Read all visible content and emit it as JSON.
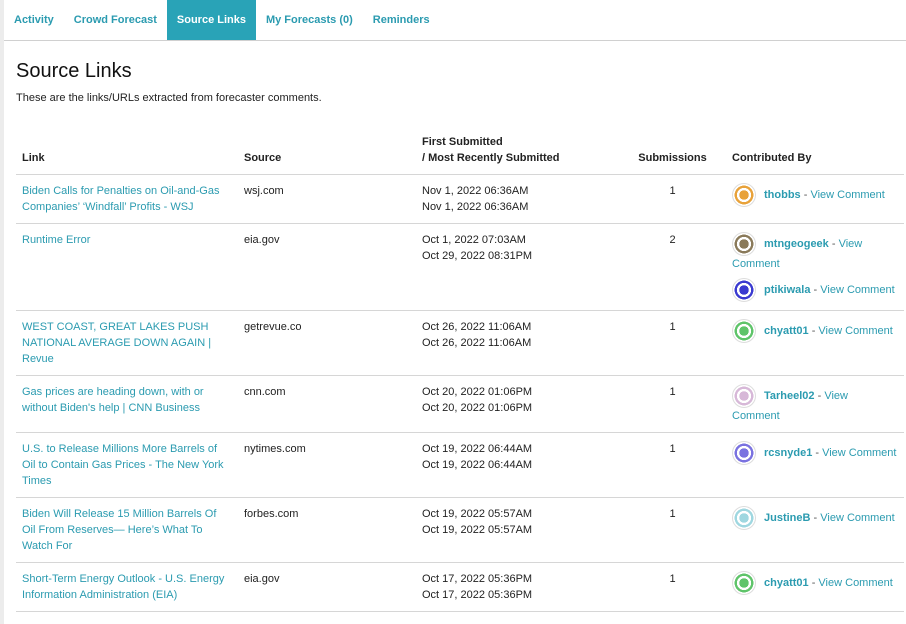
{
  "tabs": [
    {
      "label": "Activity",
      "active": false
    },
    {
      "label": "Crowd Forecast",
      "active": false
    },
    {
      "label": "Source Links",
      "active": true
    },
    {
      "label": "My Forecasts (0)",
      "active": false
    },
    {
      "label": "Reminders",
      "active": false
    }
  ],
  "page_title": "Source Links",
  "subtitle": "These are the links/URLs extracted from forecaster comments.",
  "columns": {
    "link": "Link",
    "source": "Source",
    "date_line1": "First Submitted",
    "date_line2": "/ Most Recently Submitted",
    "submissions": "Submissions",
    "contributed": "Contributed By"
  },
  "view_comment_label": "View Comment",
  "rows": [
    {
      "link": "Biden Calls for Penalties on Oil-and-Gas Companies’ ‘Windfall’ Profits - WSJ",
      "source": "wsj.com",
      "first": "Nov 1, 2022 06:36AM",
      "recent": "Nov 1, 2022 06:36AM",
      "submissions": "1",
      "contributors": [
        {
          "name": "thobbs",
          "color": "#e8a23a"
        }
      ]
    },
    {
      "link": "Runtime Error",
      "source": "eia.gov",
      "first": "Oct 1, 2022 07:03AM",
      "recent": "Oct 29, 2022 08:31PM",
      "submissions": "2",
      "contributors": [
        {
          "name": "mtngeogeek",
          "color": "#8a7a5a"
        },
        {
          "name": "ptikiwala",
          "color": "#3a3ad0"
        }
      ]
    },
    {
      "link": "WEST COAST, GREAT LAKES PUSH NATIONAL AVERAGE DOWN AGAIN | Revue",
      "source": "getrevue.co",
      "first": "Oct 26, 2022 11:06AM",
      "recent": "Oct 26, 2022 11:06AM",
      "submissions": "1",
      "contributors": [
        {
          "name": "chyatt01",
          "color": "#5fc46a"
        }
      ]
    },
    {
      "link": "Gas prices are heading down, with or without Biden's help | CNN Business",
      "source": "cnn.com",
      "first": "Oct 20, 2022 01:06PM",
      "recent": "Oct 20, 2022 01:06PM",
      "submissions": "1",
      "contributors": [
        {
          "name": "Tarheel02",
          "color": "#d7b8d8"
        }
      ]
    },
    {
      "link": "U.S. to Release Millions More Barrels of Oil to Contain Gas Prices - The New York Times",
      "source": "nytimes.com",
      "first": "Oct 19, 2022 06:44AM",
      "recent": "Oct 19, 2022 06:44AM",
      "submissions": "1",
      "contributors": [
        {
          "name": "rcsnyde1",
          "color": "#7a72e0"
        }
      ]
    },
    {
      "link": "Biden Will Release 15 Million Barrels Of Oil From Reserves— Here’s What To Watch For",
      "source": "forbes.com",
      "first": "Oct 19, 2022 05:57AM",
      "recent": "Oct 19, 2022 05:57AM",
      "submissions": "1",
      "contributors": [
        {
          "name": "JustineB",
          "color": "#9fd7e0"
        }
      ]
    },
    {
      "link": "Short-Term Energy Outlook - U.S. Energy Information Administration (EIA)",
      "source": "eia.gov",
      "first": "Oct 17, 2022 05:36PM",
      "recent": "Oct 17, 2022 05:36PM",
      "submissions": "1",
      "contributors": [
        {
          "name": "chyatt01",
          "color": "#5fc46a"
        }
      ]
    }
  ]
}
